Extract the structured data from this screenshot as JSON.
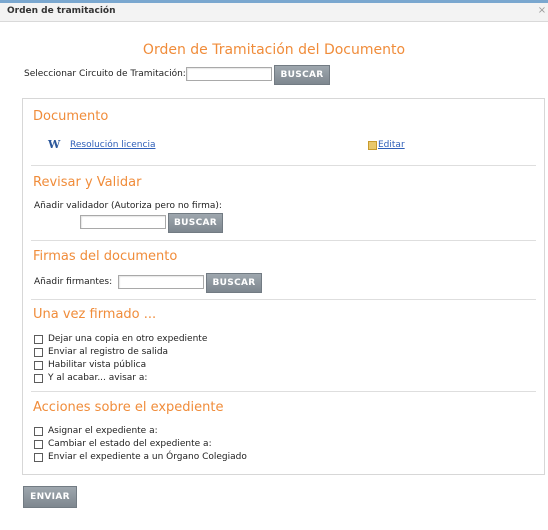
{
  "window": {
    "title": "Orden de tramitación",
    "close_glyph": "×"
  },
  "header": {
    "title": "Orden de Tramitación del Documento"
  },
  "circuit": {
    "label": "Seleccionar Circuito de Tramitación:",
    "value": "",
    "button": "BUSCAR"
  },
  "documento": {
    "heading": "Documento",
    "file_link": "Resolución licencia",
    "edit_link": "Editar"
  },
  "revisar": {
    "heading": "Revisar y Validar",
    "label": "Añadir validador (Autoriza pero no firma):",
    "value": "",
    "button": "BUSCAR"
  },
  "firmas": {
    "heading": "Firmas del documento",
    "label": "Añadir firmantes:",
    "value": "",
    "button": "BUSCAR"
  },
  "firmado": {
    "heading": "Una vez firmado ...",
    "options": [
      {
        "label": "Dejar una copia en otro expediente",
        "checked": false
      },
      {
        "label": "Enviar al registro de salida",
        "checked": false
      },
      {
        "label": "Habilitar vista pública",
        "checked": false
      },
      {
        "label": "Y al acabar... avisar a:",
        "checked": false
      }
    ]
  },
  "acciones": {
    "heading": "Acciones sobre el expediente",
    "options": [
      {
        "label": "Asignar el expediente a:",
        "checked": false
      },
      {
        "label": "Cambiar el estado del expediente a:",
        "checked": false
      },
      {
        "label": "Enviar el expediente a un Órgano Colegiado",
        "checked": false
      }
    ]
  },
  "footer": {
    "submit": "ENVIAR"
  },
  "icons": {
    "word": "word-document-icon",
    "edit": "edit-pencil-icon"
  },
  "colors": {
    "accent": "#f08c3a",
    "button": "#8a939a",
    "link": "#2f5fb8",
    "frame_top": "#7aa7cf"
  }
}
